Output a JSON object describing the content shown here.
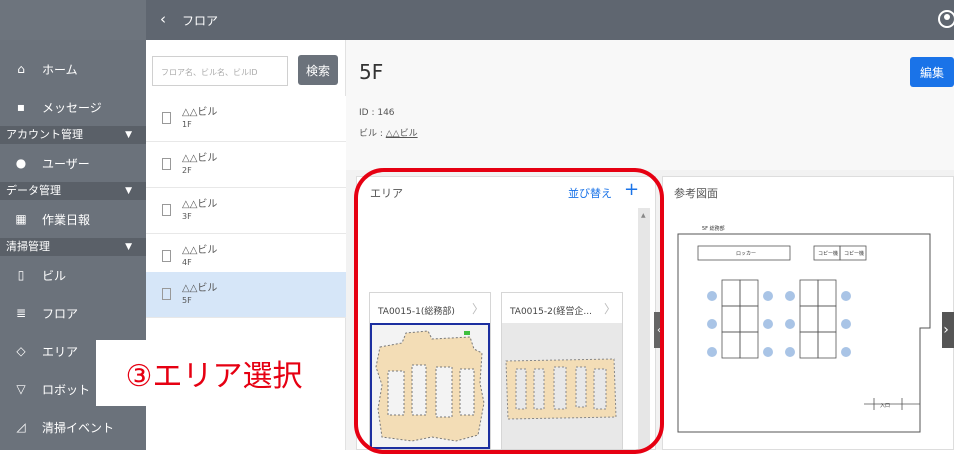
{
  "topbar": {
    "title": "フロア",
    "back_label": "‹"
  },
  "sidebar": {
    "items": [
      {
        "label": "ホーム",
        "icon": "home-icon"
      },
      {
        "label": "メッセージ",
        "icon": "message-icon"
      },
      {
        "label": "ユーザー",
        "icon": "user-icon"
      },
      {
        "label": "作業日報",
        "icon": "report-icon"
      },
      {
        "label": "ビル",
        "icon": "building-icon"
      },
      {
        "label": "フロア",
        "icon": "floor-icon"
      },
      {
        "label": "エリア",
        "icon": "area-icon"
      },
      {
        "label": "ロボット",
        "icon": "robot-icon"
      },
      {
        "label": "清掃イベント",
        "icon": "cleaning-event-icon"
      }
    ],
    "sections": [
      {
        "label": "アカウント管理"
      },
      {
        "label": "データ管理"
      },
      {
        "label": "清掃管理"
      }
    ]
  },
  "search": {
    "placeholder": "フロア名、ビル名、ビルID",
    "button_label": "検索"
  },
  "floor_list": [
    {
      "building": "△△ビル",
      "floor": "1F",
      "selected": false
    },
    {
      "building": "△△ビル",
      "floor": "2F",
      "selected": false
    },
    {
      "building": "△△ビル",
      "floor": "3F",
      "selected": false
    },
    {
      "building": "△△ビル",
      "floor": "4F",
      "selected": false
    },
    {
      "building": "△△ビル",
      "floor": "5F",
      "selected": true
    }
  ],
  "detail": {
    "title": "5F",
    "edit_label": "編集",
    "id_text": "ID : 146",
    "building_label": "ビル : ",
    "building_name": "△△ビル"
  },
  "area_panel": {
    "label": "エリア",
    "sort_label": "並び替え",
    "add_label": "+",
    "tiles": [
      {
        "name": "TA0015-1(総務部)",
        "selected": true
      },
      {
        "name": "TA0015-2(経営企...",
        "selected": false
      }
    ]
  },
  "reference_panel": {
    "label": "参考図面",
    "drawing_title": "5F 総務部",
    "locker": "ロッカー",
    "copy1": "コピー機",
    "copy2": "コピー機",
    "entrance": "入口"
  },
  "annotation": {
    "text": "③エリア選択",
    "color": "#e60012"
  },
  "colors": {
    "accent": "#1a73e8",
    "sidebar": "#6b727b",
    "selected_row": "#d6e6f8",
    "annotation": "#e60012"
  }
}
